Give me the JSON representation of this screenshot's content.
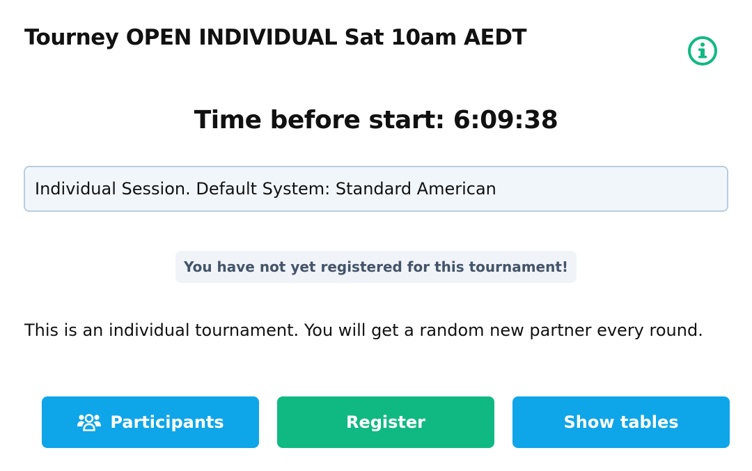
{
  "header": {
    "title": "Tourney OPEN INDIVIDUAL Sat 10am AEDT",
    "info_icon": "info-circle-icon",
    "info_color": "#10b981"
  },
  "countdown": {
    "text": "Time before start: 6:09:38"
  },
  "session": {
    "description": "Individual Session. Default System: Standard American"
  },
  "registration": {
    "notice": "You have not yet registered for this tournament!"
  },
  "tournament": {
    "info": "This is an individual tournament. You will get a random new partner every round."
  },
  "actions": {
    "participants_label": "Participants",
    "participants_icon": "users-icon",
    "register_label": "Register",
    "show_tables_label": "Show tables",
    "primary_color": "#0ea5e9",
    "register_color": "#10b981"
  }
}
